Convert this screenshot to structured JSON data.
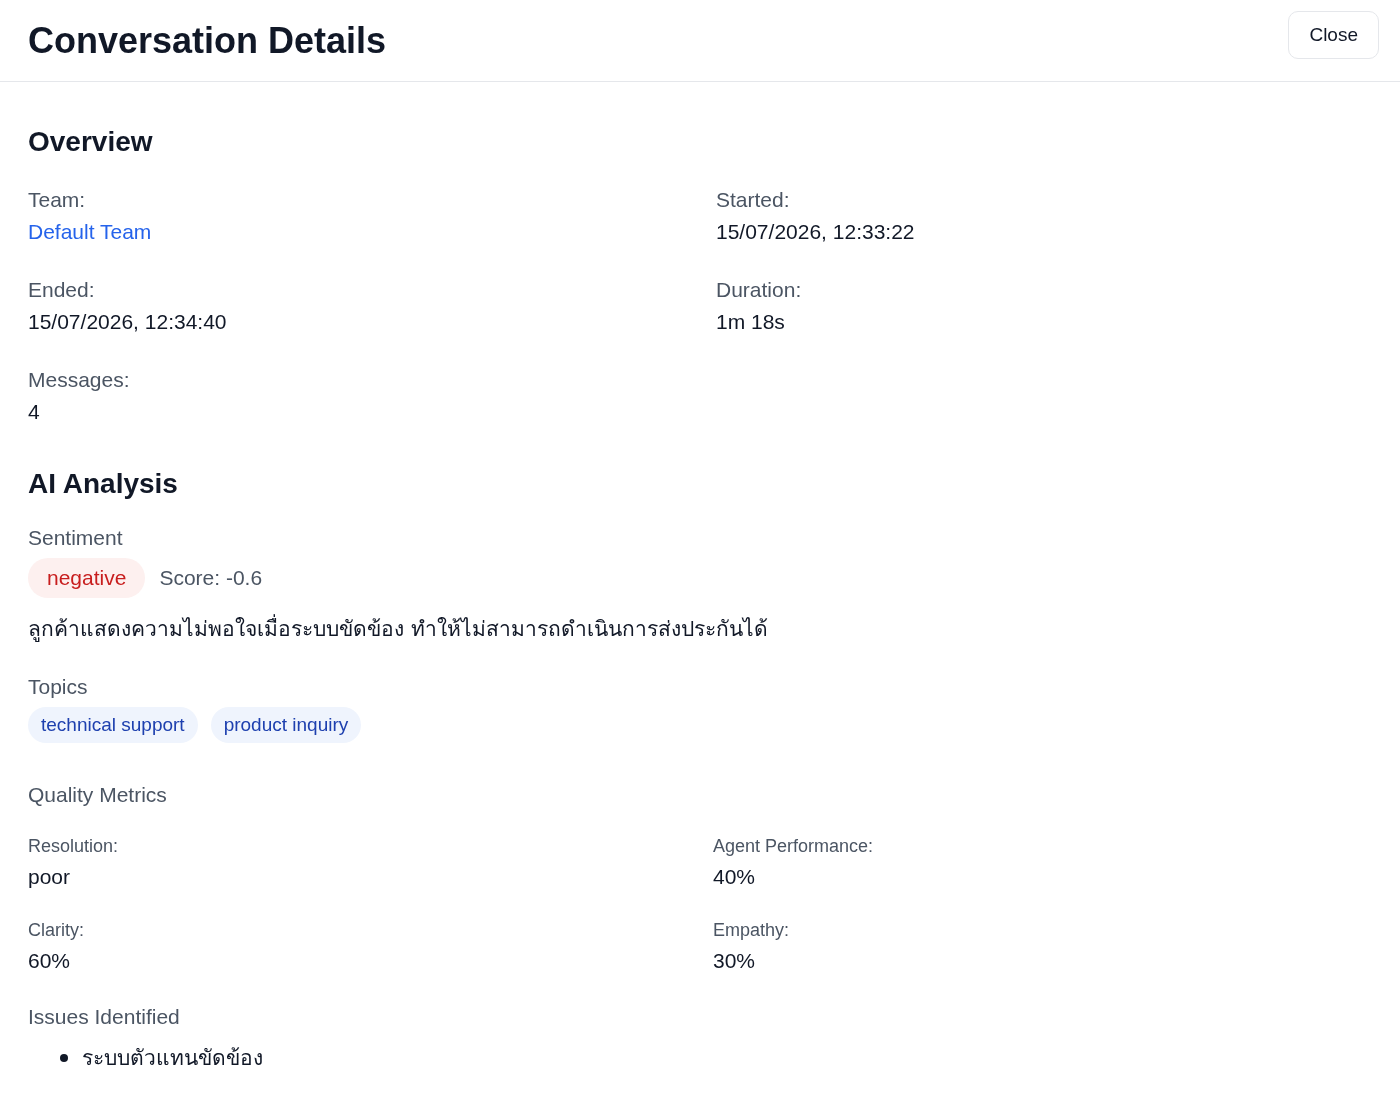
{
  "header": {
    "title": "Conversation Details",
    "close_button": "Close"
  },
  "overview": {
    "title": "Overview",
    "fields": [
      {
        "label": "Team:",
        "value": "Default Team",
        "kind": "link"
      },
      {
        "label": "Started:",
        "value": "15/07/2026, 12:33:22",
        "kind": "text"
      },
      {
        "label": "Ended:",
        "value": "15/07/2026, 12:34:40",
        "kind": "text"
      },
      {
        "label": "Duration:",
        "value": "1m 18s",
        "kind": "text"
      },
      {
        "label": "Messages:",
        "value": "4",
        "kind": "text"
      }
    ]
  },
  "analysis": {
    "title": "AI Analysis",
    "sentiment": {
      "heading": "Sentiment",
      "badge": "negative",
      "kind": "negative",
      "score": "Score: -0.6",
      "summary": "ลูกค้าแสดงความไม่พอใจเมื่อระบบขัดข้อง ทำให้ไม่สามารถดำเนินการส่งประกันได้"
    },
    "topics": {
      "heading": "Topics",
      "tags": [
        "technical support",
        "product inquiry"
      ]
    },
    "quality": {
      "heading": "Quality Metrics",
      "metrics": [
        {
          "label": "Resolution:",
          "value": "poor"
        },
        {
          "label": "Agent Performance:",
          "value": "40%"
        },
        {
          "label": "Clarity:",
          "value": "60%"
        },
        {
          "label": "Empathy:",
          "value": "30%"
        }
      ]
    },
    "issues": {
      "heading": "Issues Identified",
      "items": [
        "ระบบตัวแทนขัดข้อง"
      ]
    }
  }
}
